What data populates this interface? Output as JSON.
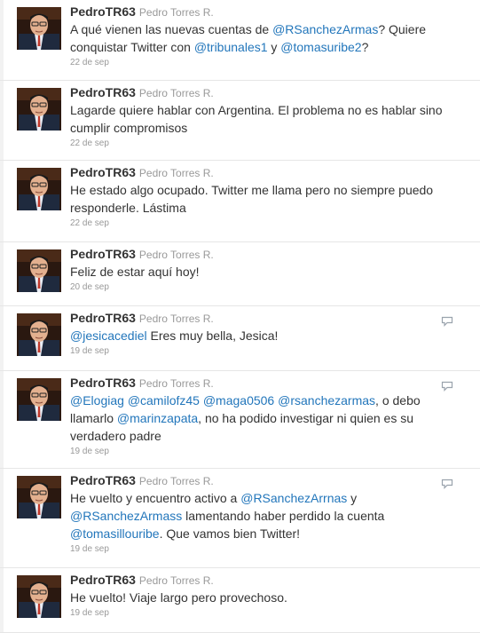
{
  "timeline": {
    "tweets": [
      {
        "handle": "PedroTR63",
        "name": "Pedro Torres R.",
        "parts": [
          {
            "t": "A qué vienen las nuevas cuentas de ",
            "m": false
          },
          {
            "t": "@RSanchezArmas",
            "m": true
          },
          {
            "t": "? Quiere conquistar Twitter con ",
            "m": false
          },
          {
            "t": "@tribunales1",
            "m": true
          },
          {
            "t": " y ",
            "m": false
          },
          {
            "t": "@tomasuribe2",
            "m": true
          },
          {
            "t": "?",
            "m": false
          }
        ],
        "time": "22 de sep",
        "reply": false
      },
      {
        "handle": "PedroTR63",
        "name": "Pedro Torres R.",
        "parts": [
          {
            "t": "Lagarde quiere hablar con Argentina. El problema no es hablar sino cumplir compromisos",
            "m": false
          }
        ],
        "time": "22 de sep",
        "reply": false
      },
      {
        "handle": "PedroTR63",
        "name": "Pedro Torres R.",
        "parts": [
          {
            "t": "He estado algo ocupado. Twitter me llama pero no siempre puedo responderle. Lástima",
            "m": false
          }
        ],
        "time": "22 de sep",
        "reply": false
      },
      {
        "handle": "PedroTR63",
        "name": "Pedro Torres R.",
        "parts": [
          {
            "t": "Feliz de estar aquí hoy!",
            "m": false
          }
        ],
        "time": "20 de sep",
        "reply": false
      },
      {
        "handle": "PedroTR63",
        "name": "Pedro Torres R.",
        "parts": [
          {
            "t": "@jesicacediel",
            "m": true
          },
          {
            "t": " Eres muy bella, Jesica!",
            "m": false
          }
        ],
        "time": "19 de sep",
        "reply": true
      },
      {
        "handle": "PedroTR63",
        "name": "Pedro Torres R.",
        "parts": [
          {
            "t": "@Elogiag",
            "m": true
          },
          {
            "t": " ",
            "m": false
          },
          {
            "t": "@camilofz45",
            "m": true
          },
          {
            "t": " ",
            "m": false
          },
          {
            "t": "@maga0506",
            "m": true
          },
          {
            "t": " ",
            "m": false
          },
          {
            "t": "@rsanchezarmas",
            "m": true
          },
          {
            "t": ", o debo llamarlo ",
            "m": false
          },
          {
            "t": "@marinzapata",
            "m": true
          },
          {
            "t": ", no ha podido investigar ni quien es su verdadero padre",
            "m": false
          }
        ],
        "time": "19 de sep",
        "reply": true
      },
      {
        "handle": "PedroTR63",
        "name": "Pedro Torres R.",
        "parts": [
          {
            "t": "He vuelto y encuentro activo a ",
            "m": false
          },
          {
            "t": "@RSanchezArrnas",
            "m": true
          },
          {
            "t": " y ",
            "m": false
          },
          {
            "t": "@RSanchezArmass",
            "m": true
          },
          {
            "t": " lamentando haber perdido la cuenta ",
            "m": false
          },
          {
            "t": "@tomasillouribe",
            "m": true
          },
          {
            "t": ". Que vamos bien Twitter!",
            "m": false
          }
        ],
        "time": "19 de sep",
        "reply": true
      },
      {
        "handle": "PedroTR63",
        "name": "Pedro Torres R.",
        "parts": [
          {
            "t": "He vuelto! Viaje largo pero provechoso.",
            "m": false
          }
        ],
        "time": "19 de sep",
        "reply": false
      }
    ],
    "colors": {
      "mention": "#2276bb",
      "handle": "#333333",
      "meta": "#999999",
      "divider": "#e6e6e6"
    },
    "icons": {
      "avatar": "avatar",
      "reply": "reply-icon"
    }
  }
}
